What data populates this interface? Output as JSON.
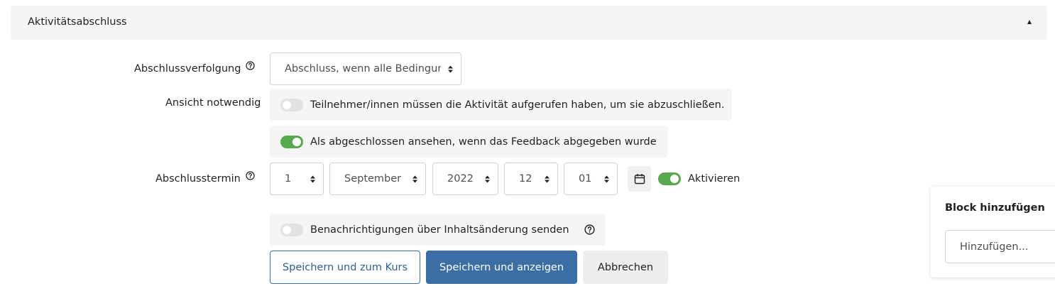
{
  "section": {
    "title": "Aktivitätsabschluss"
  },
  "completion_tracking": {
    "label": "Abschlussverfolgung",
    "value": "Abschluss, wenn alle Bedingungen erfüllt sind"
  },
  "view_required": {
    "label": "Ansicht notwendig",
    "option_text": "Teilnehmer/innen müssen die Aktivität aufgerufen haben, um sie abzuschließen.",
    "enabled": false
  },
  "feedback_submitted": {
    "option_text": "Als abgeschlossen ansehen, wenn das Feedback abgegeben wurde",
    "enabled": true
  },
  "completion_date": {
    "label": "Abschlusstermin",
    "day": "1",
    "month": "September",
    "year": "2022",
    "hour": "12",
    "minute": "01",
    "enable_label": "Aktivieren",
    "enabled": true
  },
  "notifications": {
    "option_text": "Benachrichtigungen über Inhaltsänderung senden",
    "enabled": false
  },
  "buttons": {
    "save_return": "Speichern und zum Kurs",
    "save_display": "Speichern und anzeigen",
    "cancel": "Abbrechen"
  },
  "block_panel": {
    "title": "Block hinzufügen",
    "select_value": "Hinzufügen..."
  },
  "colors": {
    "primary": "#3a6ea5",
    "toggle_on": "#57a94d",
    "toggle_off": "#e2e2e2",
    "panel_bg": "#f5f5f5"
  }
}
